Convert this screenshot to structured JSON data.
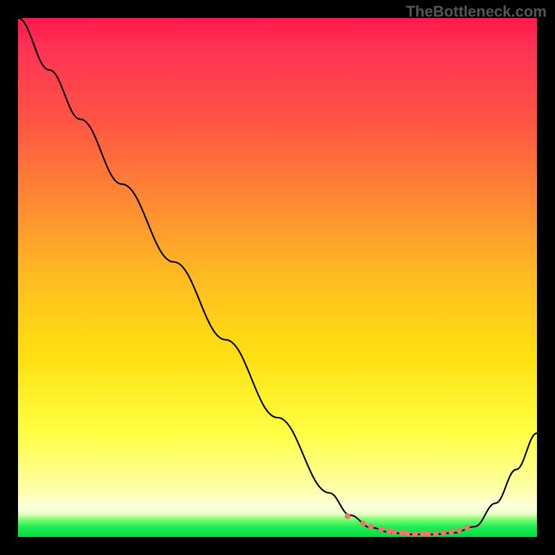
{
  "watermark": "TheBottleneck.com",
  "chart_data": {
    "type": "line",
    "title": "",
    "xlabel": "",
    "ylabel": "",
    "xlim": [
      0,
      100
    ],
    "ylim": [
      0,
      100
    ],
    "series": [
      {
        "name": "bottleneck-curve",
        "x": [
          0,
          6,
          12,
          20,
          30,
          40,
          50,
          60,
          64,
          68,
          72,
          76,
          80,
          84,
          88,
          92,
          96,
          100
        ],
        "values": [
          100,
          90,
          80.5,
          68,
          53,
          38,
          23,
          8.5,
          4.2,
          1.8,
          0.8,
          0.5,
          0.5,
          0.8,
          2.0,
          6.5,
          13,
          20
        ]
      }
    ],
    "markers": {
      "name": "threshold-dots",
      "color": "#f0776b",
      "x": [
        63.5,
        66.5,
        68,
        70,
        71.5,
        72.5,
        74,
        75,
        76.5,
        78,
        79,
        80.5,
        82,
        83.5,
        85,
        86.5
      ],
      "values": [
        4.0,
        2.6,
        2.0,
        1.5,
        1.1,
        1.0,
        0.8,
        0.7,
        0.6,
        0.6,
        0.6,
        0.7,
        0.8,
        1.0,
        1.3,
        1.8
      ]
    }
  }
}
